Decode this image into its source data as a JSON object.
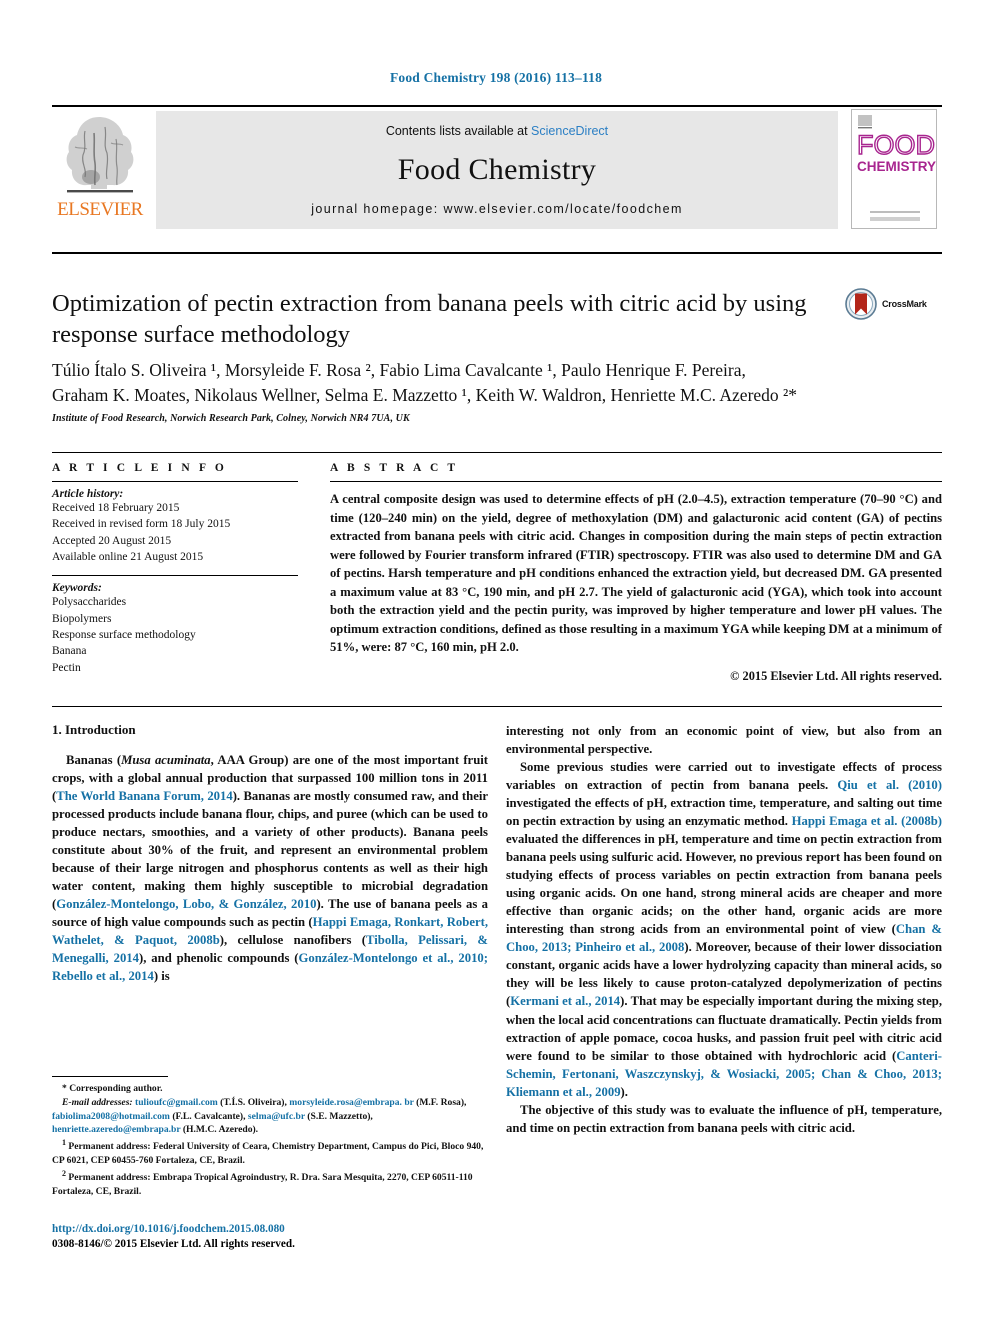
{
  "running_head": "Food Chemistry 198 (2016) 113–118",
  "masthead": {
    "publisher_name": "ELSEVIER",
    "contents_prefix": "Contents lists available at ",
    "contents_link": "ScienceDirect",
    "journal_title": "Food Chemistry",
    "homepage": "journal homepage: www.elsevier.com/locate/foodchem",
    "cover": {
      "word_top": "FOOD",
      "word_bottom": "CHEMISTRY"
    }
  },
  "article": {
    "title": "Optimization of pectin extraction from banana peels with citric acid by using response surface methodology",
    "crossmark_label": "CrossMark",
    "authors_line1": "Túlio Ítalo S. Oliveira ¹, Morsyleide F. Rosa ², Fabio Lima Cavalcante ¹, Paulo Henrique F. Pereira,",
    "authors_line2": "Graham K. Moates, Nikolaus Wellner, Selma E. Mazzetto ¹, Keith W. Waldron, Henriette M.C. Azeredo ²*",
    "affiliation": "Institute of Food Research, Norwich Research Park, Colney, Norwich NR4 7UA, UK"
  },
  "article_info": {
    "heading": "A R T I C L E   I N F O",
    "history_label": "Article history:",
    "history": [
      "Received 18 February 2015",
      "Received in revised form 18 July 2015",
      "Accepted 20 August 2015",
      "Available online 21 August 2015"
    ],
    "keywords_label": "Keywords:",
    "keywords": [
      "Polysaccharides",
      "Biopolymers",
      "Response surface methodology",
      "Banana",
      "Pectin"
    ]
  },
  "abstract": {
    "heading": "A B S T R A C T",
    "text": "A central composite design was used to determine effects of pH (2.0–4.5), extraction temperature (70–90 °C) and time (120–240 min) on the yield, degree of methoxylation (DM) and galacturonic acid content (GA) of pectins extracted from banana peels with citric acid. Changes in composition during the main steps of pectin extraction were followed by Fourier transform infrared (FTIR) spectroscopy. FTIR was also used to determine DM and GA of pectins. Harsh temperature and pH conditions enhanced the extraction yield, but decreased DM. GA presented a maximum value at 83 °C, 190 min, and pH 2.7. The yield of galacturonic acid (YGA), which took into account both the extraction yield and the pectin purity, was improved by higher temperature and lower pH values. The optimum extraction conditions, defined as those resulting in a maximum YGA while keeping DM at a minimum of 51%, were: 87 °C, 160 min, pH 2.0.",
    "copyright": "© 2015 Elsevier Ltd. All rights reserved."
  },
  "body": {
    "section_heading": "1. Introduction",
    "left_para_1_a": "Bananas (",
    "left_para_1_italic": "Musa acuminata",
    "left_para_1_b": ", AAA Group) are one of the most important fruit crops, with a global annual production that surpassed 100 million tons in 2011 (",
    "left_cite_1": "The World Banana Forum, 2014",
    "left_para_1_c": "). Bananas are mostly consumed raw, and their processed products include banana flour, chips, and puree (which can be used to produce nectars, smoothies, and a variety of other products). Banana peels constitute about 30% of the fruit, and represent an environmental problem because of their large nitrogen and phosphorus contents as well as their high water content, making them highly susceptible to microbial degradation (",
    "left_cite_2": "González-Montelongo, Lobo, & González, 2010",
    "left_para_1_d": "). The use of banana peels as a source of high value compounds such as pectin (",
    "left_cite_3": "Happi Emaga, Ronkart, Robert, Wathelet, & Paquot, 2008b",
    "left_para_1_e": "), cellulose nanofibers (",
    "left_cite_4": "Tibolla, Pelissari, & Menegalli, 2014",
    "left_para_1_f": "), and phenolic compounds (",
    "left_cite_5": "González-Montelongo et al., 2010; Rebello et al., 2014",
    "left_para_1_g": ") is",
    "right_para_1": "interesting not only from an economic point of view, but also from an environmental perspective.",
    "right_para_2_a": "Some previous studies were carried out to investigate effects of process variables on extraction of pectin from banana peels. ",
    "right_cite_1": "Qiu et al. (2010)",
    "right_para_2_b": " investigated the effects of pH, extraction time, temperature, and salting out time on pectin extraction by using an enzymatic method. ",
    "right_cite_2": "Happi Emaga et al. (2008b)",
    "right_para_2_c": " evaluated the differences in pH, temperature and time on pectin extraction from banana peels using sulfuric acid. However, no previous report has been found on studying effects of process variables on pectin extraction from banana peels using organic acids. On one hand, strong mineral acids are cheaper and more effective than organic acids; on the other hand, organic acids are more interesting than strong acids from an environmental point of view (",
    "right_cite_3": "Chan & Choo, 2013; Pinheiro et al., 2008",
    "right_para_2_d": "). Moreover, because of their lower dissociation constant, organic acids have a lower hydrolyzing capacity than mineral acids, so they will be less likely to cause proton-catalyzed depolymerization of pectins (",
    "right_cite_4": "Kermani et al., 2014",
    "right_para_2_e": "). That may be especially important during the mixing step, when the local acid concentrations can fluctuate dramatically. Pectin yields from extraction of apple pomace, cocoa husks, and passion fruit peel with citric acid were found to be similar to those obtained with hydrochloric acid (",
    "right_cite_5": "Canteri-Schemin, Fertonani, Waszczynskyj, & Wosiacki, 2005; Chan & Choo, 2013; Kliemann et al., 2009",
    "right_para_2_f": ").",
    "right_para_3": "The objective of this study was to evaluate the influence of pH, temperature, and time on pectin extraction from banana peels with citric acid."
  },
  "footnotes": {
    "corresponding": "* Corresponding author.",
    "email_label": "E-mail addresses:",
    "email_1": "tulioufc@gmail.com",
    "email_1_owner": " (T.Í.S. Oliveira), ",
    "email_2": "morsyleide.rosa@embrapa. br",
    "email_2_owner": " (M.F. Rosa), ",
    "email_3": "fabiolima2008@hotmail.com",
    "email_3_owner": " (F.L. Cavalcante), ",
    "email_4": "selma@ufc.br",
    "email_4_owner": " (S.E. Mazzetto), ",
    "email_5": "henriette.azeredo@embrapa.br",
    "email_5_owner": " (H.M.C. Azeredo).",
    "note_1_marker": "1",
    "note_1": "Permanent address: Federal University of Ceara, Chemistry Department, Campus do Pici, Bloco 940, CP 6021, CEP 60455-760 Fortaleza, CE, Brazil.",
    "note_2_marker": "2",
    "note_2": "Permanent address: Embrapa Tropical Agroindustry, R. Dra. Sara Mesquita, 2270, CEP 60511-110 Fortaleza, CE, Brazil."
  },
  "imprint": {
    "doi_url": "http://dx.doi.org/10.1016/j.foodchem.2015.08.080",
    "issn_line": "0308-8146/© 2015 Elsevier Ltd. All rights reserved."
  },
  "colors": {
    "link_blue": "#1571a5",
    "sciencedirect_blue": "#2b7fc4",
    "elsevier_orange": "#e87722",
    "cover_magenta": "#a8258f",
    "crossmark_red": "#b3261a"
  }
}
